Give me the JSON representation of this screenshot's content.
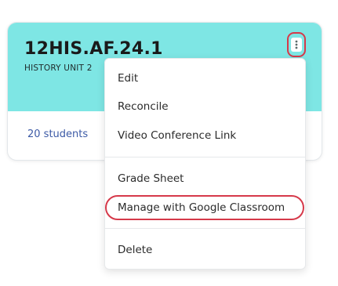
{
  "card": {
    "code": "12HIS.AF.24.1",
    "subtitle": "HISTORY UNIT 2",
    "students": "20 students",
    "header_color": "#7ee6e4",
    "menu_icon": "vertical-ellipsis-icon"
  },
  "menu": {
    "items": [
      {
        "label": "Edit"
      },
      {
        "label": "Reconcile"
      },
      {
        "label": "Video Conference Link"
      },
      {
        "label": "Grade Sheet"
      },
      {
        "label": "Manage with Google Classroom",
        "highlighted": true
      },
      {
        "label": "Delete"
      }
    ]
  },
  "highlight_color": "#d6394a"
}
